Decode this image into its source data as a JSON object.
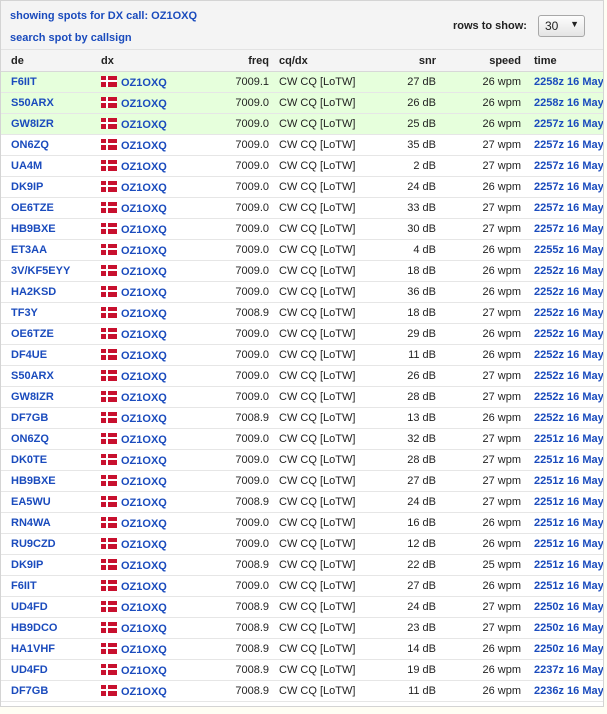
{
  "header": {
    "title": "showing spots for DX call: OZ1OXQ",
    "search_link": "search spot by callsign",
    "rows_label": "rows to show:",
    "rows_value": "30"
  },
  "columns": [
    "de",
    "dx",
    "freq",
    "cq/dx",
    "snr",
    "speed",
    "time"
  ],
  "highlight_color": "#e6ffdc",
  "link_color": "#1a4bbd",
  "spots": [
    {
      "de": "F6IIT",
      "dx": "OZ1OXQ",
      "freq": "7009.1",
      "mode": "CW CQ [LoTW]",
      "snr": "27 dB",
      "speed": "26 wpm",
      "time": "2258z 16 May",
      "highlight": true
    },
    {
      "de": "S50ARX",
      "dx": "OZ1OXQ",
      "freq": "7009.0",
      "mode": "CW CQ [LoTW]",
      "snr": "26 dB",
      "speed": "26 wpm",
      "time": "2258z 16 May",
      "highlight": true
    },
    {
      "de": "GW8IZR",
      "dx": "OZ1OXQ",
      "freq": "7009.0",
      "mode": "CW CQ [LoTW]",
      "snr": "25 dB",
      "speed": "26 wpm",
      "time": "2257z 16 May",
      "highlight": true
    },
    {
      "de": "ON6ZQ",
      "dx": "OZ1OXQ",
      "freq": "7009.0",
      "mode": "CW CQ [LoTW]",
      "snr": "35 dB",
      "speed": "27 wpm",
      "time": "2257z 16 May"
    },
    {
      "de": "UA4M",
      "dx": "OZ1OXQ",
      "freq": "7009.0",
      "mode": "CW CQ [LoTW]",
      "snr": "2 dB",
      "speed": "27 wpm",
      "time": "2257z 16 May"
    },
    {
      "de": "DK9IP",
      "dx": "OZ1OXQ",
      "freq": "7009.0",
      "mode": "CW CQ [LoTW]",
      "snr": "24 dB",
      "speed": "26 wpm",
      "time": "2257z 16 May"
    },
    {
      "de": "OE6TZE",
      "dx": "OZ1OXQ",
      "freq": "7009.0",
      "mode": "CW CQ [LoTW]",
      "snr": "33 dB",
      "speed": "27 wpm",
      "time": "2257z 16 May"
    },
    {
      "de": "HB9BXE",
      "dx": "OZ1OXQ",
      "freq": "7009.0",
      "mode": "CW CQ [LoTW]",
      "snr": "30 dB",
      "speed": "27 wpm",
      "time": "2257z 16 May"
    },
    {
      "de": "ET3AA",
      "dx": "OZ1OXQ",
      "freq": "7009.0",
      "mode": "CW CQ [LoTW]",
      "snr": "4 dB",
      "speed": "26 wpm",
      "time": "2255z 16 May"
    },
    {
      "de": "3V/KF5EYY",
      "dx": "OZ1OXQ",
      "freq": "7009.0",
      "mode": "CW CQ [LoTW]",
      "snr": "18 dB",
      "speed": "26 wpm",
      "time": "2252z 16 May"
    },
    {
      "de": "HA2KSD",
      "dx": "OZ1OXQ",
      "freq": "7009.0",
      "mode": "CW CQ [LoTW]",
      "snr": "36 dB",
      "speed": "26 wpm",
      "time": "2252z 16 May"
    },
    {
      "de": "TF3Y",
      "dx": "OZ1OXQ",
      "freq": "7008.9",
      "mode": "CW CQ [LoTW]",
      "snr": "18 dB",
      "speed": "27 wpm",
      "time": "2252z 16 May"
    },
    {
      "de": "OE6TZE",
      "dx": "OZ1OXQ",
      "freq": "7009.0",
      "mode": "CW CQ [LoTW]",
      "snr": "29 dB",
      "speed": "26 wpm",
      "time": "2252z 16 May"
    },
    {
      "de": "DF4UE",
      "dx": "OZ1OXQ",
      "freq": "7009.0",
      "mode": "CW CQ [LoTW]",
      "snr": "11 dB",
      "speed": "26 wpm",
      "time": "2252z 16 May"
    },
    {
      "de": "S50ARX",
      "dx": "OZ1OXQ",
      "freq": "7009.0",
      "mode": "CW CQ [LoTW]",
      "snr": "26 dB",
      "speed": "27 wpm",
      "time": "2252z 16 May"
    },
    {
      "de": "GW8IZR",
      "dx": "OZ1OXQ",
      "freq": "7009.0",
      "mode": "CW CQ [LoTW]",
      "snr": "28 dB",
      "speed": "27 wpm",
      "time": "2252z 16 May"
    },
    {
      "de": "DF7GB",
      "dx": "OZ1OXQ",
      "freq": "7008.9",
      "mode": "CW CQ [LoTW]",
      "snr": "13 dB",
      "speed": "26 wpm",
      "time": "2252z 16 May"
    },
    {
      "de": "ON6ZQ",
      "dx": "OZ1OXQ",
      "freq": "7009.0",
      "mode": "CW CQ [LoTW]",
      "snr": "32 dB",
      "speed": "27 wpm",
      "time": "2251z 16 May"
    },
    {
      "de": "DK0TE",
      "dx": "OZ1OXQ",
      "freq": "7009.0",
      "mode": "CW CQ [LoTW]",
      "snr": "28 dB",
      "speed": "27 wpm",
      "time": "2251z 16 May"
    },
    {
      "de": "HB9BXE",
      "dx": "OZ1OXQ",
      "freq": "7009.0",
      "mode": "CW CQ [LoTW]",
      "snr": "27 dB",
      "speed": "27 wpm",
      "time": "2251z 16 May"
    },
    {
      "de": "EA5WU",
      "dx": "OZ1OXQ",
      "freq": "7008.9",
      "mode": "CW CQ [LoTW]",
      "snr": "24 dB",
      "speed": "27 wpm",
      "time": "2251z 16 May"
    },
    {
      "de": "RN4WA",
      "dx": "OZ1OXQ",
      "freq": "7009.0",
      "mode": "CW CQ [LoTW]",
      "snr": "16 dB",
      "speed": "26 wpm",
      "time": "2251z 16 May"
    },
    {
      "de": "RU9CZD",
      "dx": "OZ1OXQ",
      "freq": "7009.0",
      "mode": "CW CQ [LoTW]",
      "snr": "12 dB",
      "speed": "26 wpm",
      "time": "2251z 16 May"
    },
    {
      "de": "DK9IP",
      "dx": "OZ1OXQ",
      "freq": "7008.9",
      "mode": "CW CQ [LoTW]",
      "snr": "22 dB",
      "speed": "25 wpm",
      "time": "2251z 16 May"
    },
    {
      "de": "F6IIT",
      "dx": "OZ1OXQ",
      "freq": "7009.0",
      "mode": "CW CQ [LoTW]",
      "snr": "27 dB",
      "speed": "26 wpm",
      "time": "2251z 16 May"
    },
    {
      "de": "UD4FD",
      "dx": "OZ1OXQ",
      "freq": "7008.9",
      "mode": "CW CQ [LoTW]",
      "snr": "24 dB",
      "speed": "27 wpm",
      "time": "2250z 16 May"
    },
    {
      "de": "HB9DCO",
      "dx": "OZ1OXQ",
      "freq": "7008.9",
      "mode": "CW CQ [LoTW]",
      "snr": "23 dB",
      "speed": "27 wpm",
      "time": "2250z 16 May"
    },
    {
      "de": "HA1VHF",
      "dx": "OZ1OXQ",
      "freq": "7008.9",
      "mode": "CW CQ [LoTW]",
      "snr": "14 dB",
      "speed": "26 wpm",
      "time": "2250z 16 May"
    },
    {
      "de": "UD4FD",
      "dx": "OZ1OXQ",
      "freq": "7008.9",
      "mode": "CW CQ [LoTW]",
      "snr": "19 dB",
      "speed": "26 wpm",
      "time": "2237z 16 May"
    },
    {
      "de": "DF7GB",
      "dx": "OZ1OXQ",
      "freq": "7008.9",
      "mode": "CW CQ [LoTW]",
      "snr": "11 dB",
      "speed": "26 wpm",
      "time": "2236z 16 May"
    }
  ]
}
